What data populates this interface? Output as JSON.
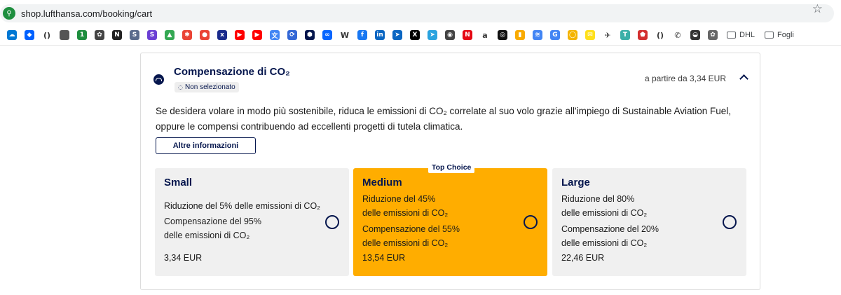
{
  "browser": {
    "url": "shop.lufthansa.com/booking/cart",
    "bookmark_icons": [
      {
        "name": "onedrive-icon",
        "color": "#0078d4",
        "glyph": "☁"
      },
      {
        "name": "dropbox-icon",
        "color": "#0061ff",
        "glyph": "◆"
      },
      {
        "name": "code-brackets-icon",
        "color": "",
        "glyph": "()"
      },
      {
        "name": "apple-icon",
        "color": "#555555",
        "glyph": ""
      },
      {
        "name": "green-badge-icon",
        "color": "#1e8e3e",
        "glyph": "1"
      },
      {
        "name": "openai-icon",
        "color": "#444444",
        "glyph": "✿"
      },
      {
        "name": "notion-icon",
        "color": "#222222",
        "glyph": "N"
      },
      {
        "name": "bookmark-s-icon",
        "color": "#5a6b8c",
        "glyph": "S"
      },
      {
        "name": "purple-s-icon",
        "color": "#6b3fd4",
        "glyph": "S"
      },
      {
        "name": "google-drive-icon",
        "color": "#34a853",
        "glyph": "▲"
      },
      {
        "name": "pinwheel-icon",
        "color": "#ea4335",
        "glyph": "✱"
      },
      {
        "name": "maps-pin-icon",
        "color": "#ea4335",
        "glyph": "●"
      },
      {
        "name": "xe-icon",
        "color": "#1a2b8c",
        "glyph": "x"
      },
      {
        "name": "youtube-icon",
        "color": "#ff0000",
        "glyph": "▶"
      },
      {
        "name": "youtube-icon-2",
        "color": "#ff0000",
        "glyph": "▶"
      },
      {
        "name": "translate-icon",
        "color": "#4285f4",
        "glyph": "文"
      },
      {
        "name": "sync-icon",
        "color": "#3367d6",
        "glyph": "⟳"
      },
      {
        "name": "hexagon-icon",
        "color": "#05164d",
        "glyph": "⬢"
      },
      {
        "name": "meta-icon",
        "color": "#0866ff",
        "glyph": "∞"
      },
      {
        "name": "wikipedia-icon",
        "color": "",
        "glyph": "W"
      },
      {
        "name": "facebook-icon",
        "color": "#1877f2",
        "glyph": "f"
      },
      {
        "name": "linkedin-icon",
        "color": "#0a66c2",
        "glyph": "in"
      },
      {
        "name": "compass-icon",
        "color": "#0a66c2",
        "glyph": "➤"
      },
      {
        "name": "x-icon",
        "color": "#000000",
        "glyph": "X"
      },
      {
        "name": "telegram-icon",
        "color": "#2aa3df",
        "glyph": "➤"
      },
      {
        "name": "owl-icon",
        "color": "#444444",
        "glyph": "◉"
      },
      {
        "name": "netflix-icon",
        "color": "#e50914",
        "glyph": "N"
      },
      {
        "name": "amazon-icon",
        "color": "",
        "glyph": "a"
      },
      {
        "name": "chatgpt-icon",
        "color": "#111111",
        "glyph": "◎"
      },
      {
        "name": "analytics-icon",
        "color": "#f9ab00",
        "glyph": "▮"
      },
      {
        "name": "wifi-icon",
        "color": "#4285f4",
        "glyph": "≋"
      },
      {
        "name": "google-icon",
        "color": "#4285f4",
        "glyph": "G"
      },
      {
        "name": "ring-icon",
        "color": "#f4b400",
        "glyph": "◯"
      },
      {
        "name": "mailchimp-icon",
        "color": "#ffe01b",
        "glyph": "✉"
      },
      {
        "name": "airplane-icon",
        "color": "",
        "glyph": "✈"
      },
      {
        "name": "t-icon",
        "color": "#3ab0a8",
        "glyph": "T"
      },
      {
        "name": "location-icon",
        "color": "#d32f2f",
        "glyph": "⬟"
      },
      {
        "name": "code-brackets-icon-2",
        "color": "",
        "glyph": "()"
      },
      {
        "name": "phone-icon",
        "color": "",
        "glyph": "✆"
      },
      {
        "name": "mask-icon",
        "color": "#333333",
        "glyph": "◒"
      },
      {
        "name": "openai-icon-2",
        "color": "#666666",
        "glyph": "✿"
      }
    ],
    "folders": [
      "DHL",
      "Fogli"
    ]
  },
  "co2": {
    "title": "Compensazione di CO₂",
    "status": "Non selezionato",
    "price_from": "a partire da  3,34 EUR",
    "description": "Se desidera volare in modo più sostenibile, riduca le emissioni di CO₂ correlate al suo volo grazie all'impiego di Sustainable Aviation Fuel, oppure le compensi contribuendo ad eccellenti progetti di tutela climatica.",
    "more_button": "Altre informazioni",
    "top_choice_label": "Top Choice",
    "options": [
      {
        "title": "Small",
        "lines": [
          "Riduzione del 5% delle emissioni di CO₂",
          "Compensazione del 95%",
          "delle emissioni di CO₂"
        ],
        "price": "3,34 EUR",
        "selected": false
      },
      {
        "title": "Medium",
        "lines": [
          "Riduzione del 45%",
          "delle emissioni di CO₂",
          "Compensazione del 55%",
          "delle emissioni di CO₂"
        ],
        "price": "13,54 EUR",
        "selected": true
      },
      {
        "title": "Large",
        "lines": [
          "Riduzione del 80%",
          "delle emissioni di CO₂",
          "Compensazione del 20%",
          "delle emissioni di CO₂"
        ],
        "price": "22,46 EUR",
        "selected": false
      }
    ],
    "colors": {
      "brand_navy": "#05164d",
      "highlight": "#ffad00",
      "option_bg": "#f0f0f0"
    }
  }
}
